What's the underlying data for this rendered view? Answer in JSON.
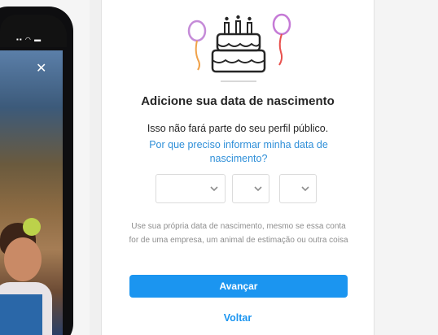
{
  "dialog": {
    "title": "Adicione sua data de nascimento",
    "subtitle": "Isso não fará parte do seu perfil público.",
    "why_link": "Por que preciso informar minha data de nascimento?",
    "note": "Use sua própria data de nascimento, mesmo se essa conta for de uma empresa, um animal de estimação ou outra coisa",
    "next_label": "Avançar",
    "back_label": "Voltar"
  },
  "selects": {
    "month_value": "",
    "day_value": "",
    "year_value": ""
  },
  "phone": {
    "close_symbol": "✕"
  },
  "icons": {
    "cake": "birthday-cake-icon",
    "balloons": "balloon-icon",
    "chevron": "chevron-down-icon"
  },
  "colors": {
    "primary": "#1b95f0",
    "link": "#2f8fd8",
    "text": "#262626",
    "muted": "#8e8e8e",
    "balloon_left": "#c58bd8",
    "balloon_right": "#c57ad6"
  }
}
